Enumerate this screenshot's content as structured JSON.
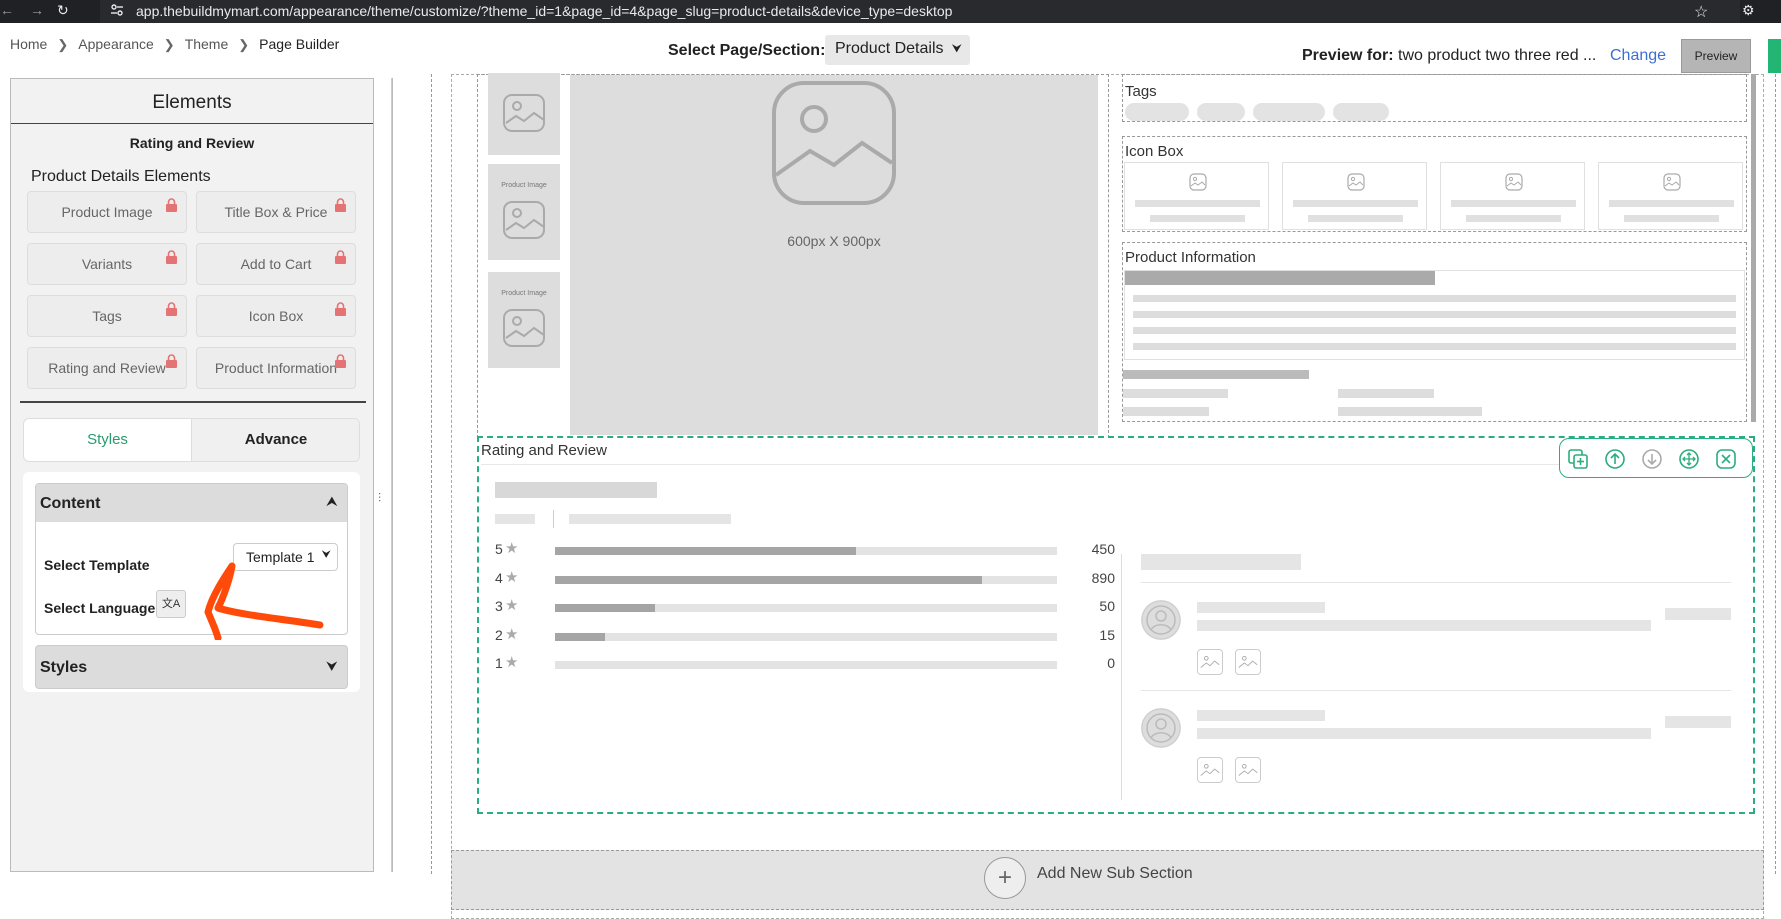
{
  "browser": {
    "url": "app.thebuildmymart.com/appearance/theme/customize/?theme_id=1&page_id=4&page_slug=product-details&device_type=desktop",
    "icons": [
      "back-arrow-icon",
      "forward-arrow-icon",
      "reload-icon",
      "site-settings-icon",
      "star-icon",
      "extension-icon"
    ]
  },
  "breadcrumb": [
    "Home",
    "Appearance",
    "Theme",
    "Page Builder"
  ],
  "topbar": {
    "select_page_label": "Select Page/Section:",
    "select_page_value": "Product Details",
    "preview_for_label": "Preview for:",
    "preview_for_value": "two product two three red ...",
    "change_label": "Change",
    "preview_button": "Preview"
  },
  "sidebar": {
    "title": "Elements",
    "subtitle": "Rating and Review",
    "elements_heading": "Product Details Elements",
    "elements": [
      {
        "label": "Product Image",
        "locked": true
      },
      {
        "label": "Title Box & Price",
        "locked": true
      },
      {
        "label": "Variants",
        "locked": true
      },
      {
        "label": "Add to Cart",
        "locked": true
      },
      {
        "label": "Tags",
        "locked": true
      },
      {
        "label": "Icon Box",
        "locked": true
      },
      {
        "label": "Rating and Review",
        "locked": true
      },
      {
        "label": "Product Information",
        "locked": true
      }
    ],
    "tabs": {
      "styles": "Styles",
      "advance": "Advance",
      "active": "Styles"
    },
    "content_section": {
      "title": "Content",
      "select_template_label": "Select Template",
      "select_template_value": "Template 1",
      "select_language_label": "Select Language",
      "language_icon": "translate-icon"
    },
    "styles_section": {
      "title": "Styles"
    }
  },
  "canvas": {
    "product_image": {
      "thumb_label": "Product Image",
      "main_image_label": "600px X 900px"
    },
    "tags_label": "Tags",
    "icon_box_label": "Icon Box",
    "product_information_label": "Product Information",
    "rating_review": {
      "label": "Rating and Review",
      "toolbar_icons": [
        "duplicate-icon",
        "move-up-icon",
        "move-down-icon",
        "drag-move-icon",
        "delete-icon"
      ],
      "ratings": [
        {
          "stars": "5",
          "count": "450",
          "fill_fraction": 0.6
        },
        {
          "stars": "4",
          "count": "890",
          "fill_fraction": 0.85
        },
        {
          "stars": "3",
          "count": "50",
          "fill_fraction": 0.2
        },
        {
          "stars": "2",
          "count": "15",
          "fill_fraction": 0.1
        },
        {
          "stars": "1",
          "count": "0",
          "fill_fraction": 0
        }
      ]
    },
    "add_section_label": "Add New Sub Section"
  },
  "colors": {
    "accent_green": "#2bae7f",
    "link_blue": "#3b6fd4",
    "lock_red": "#e57373",
    "annotation_orange": "#ff4a0a"
  }
}
